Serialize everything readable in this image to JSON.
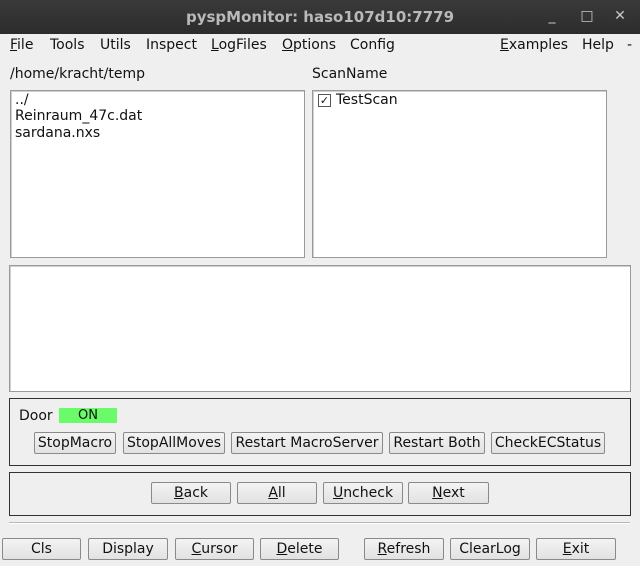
{
  "window": {
    "title": "pyspMonitor: haso107d10:7779",
    "minimize_icon": "_",
    "maximize_icon": "□",
    "close_icon": "✕"
  },
  "menubar": {
    "file": "File",
    "tools": "Tools",
    "utils": "Utils",
    "inspect": "Inspect",
    "logfiles": "LogFiles",
    "options": "Options",
    "config": "Config",
    "examples": "Examples",
    "help": "Help",
    "extra": "-"
  },
  "files": {
    "path": "/home/kracht/temp",
    "items": [
      "../",
      "Reinraum_47c.dat",
      "sardana.nxs"
    ]
  },
  "scans": {
    "header": "ScanName",
    "items": [
      {
        "label": "TestScan",
        "checked": true,
        "checkmark": "✓"
      }
    ]
  },
  "door": {
    "label": "Door",
    "status": "ON",
    "status_color": "#6afb6a",
    "buttons": [
      "StopMacro",
      "StopAllMoves",
      "Restart MacroServer",
      "Restart Both",
      "CheckECStatus"
    ]
  },
  "nav": {
    "back": "Back",
    "all": "All",
    "uncheck": "Uncheck",
    "next": "Next"
  },
  "bottom": {
    "cls": "Cls",
    "display": "Display",
    "cursor": "Cursor",
    "delete": "Delete",
    "refresh": "Refresh",
    "clearlog": "ClearLog",
    "exit": "Exit"
  }
}
